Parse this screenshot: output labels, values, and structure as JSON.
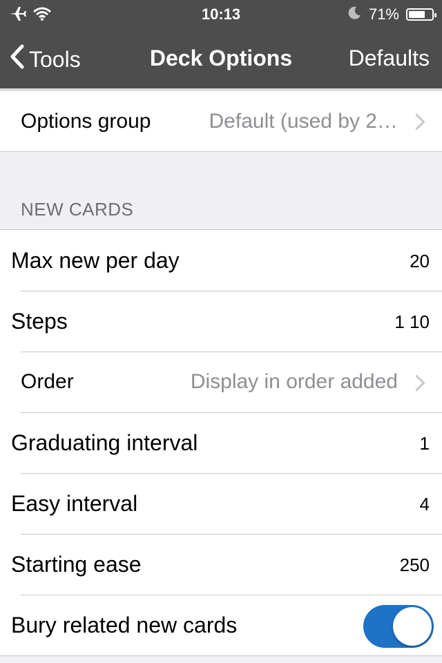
{
  "status_bar": {
    "time": "10:13",
    "battery_text": "71%",
    "battery_level": 0.71,
    "icons": [
      "airplane-icon",
      "wifi-icon",
      "moon-icon",
      "battery-icon"
    ]
  },
  "nav": {
    "back_label": "Tools",
    "title": "Deck Options",
    "right_label": "Defaults"
  },
  "options_group": {
    "label": "Options group",
    "value": "Default (used by 2…"
  },
  "new_cards": {
    "header": "NEW CARDS",
    "max_new_per_day": {
      "label": "Max new per day",
      "value": "20"
    },
    "steps": {
      "label": "Steps",
      "value": "1 10"
    },
    "order": {
      "label": "Order",
      "value": "Display in order added"
    },
    "graduating_interval": {
      "label": "Graduating interval",
      "value": "1"
    },
    "easy_interval": {
      "label": "Easy interval",
      "value": "4"
    },
    "starting_ease": {
      "label": "Starting ease",
      "value": "250"
    },
    "bury_related": {
      "label": "Bury related new cards",
      "enabled": true
    }
  },
  "colors": {
    "bar_background": "#4d4d4d",
    "toggle_on": "#1e73c6",
    "muted_text": "#8e8e93"
  }
}
